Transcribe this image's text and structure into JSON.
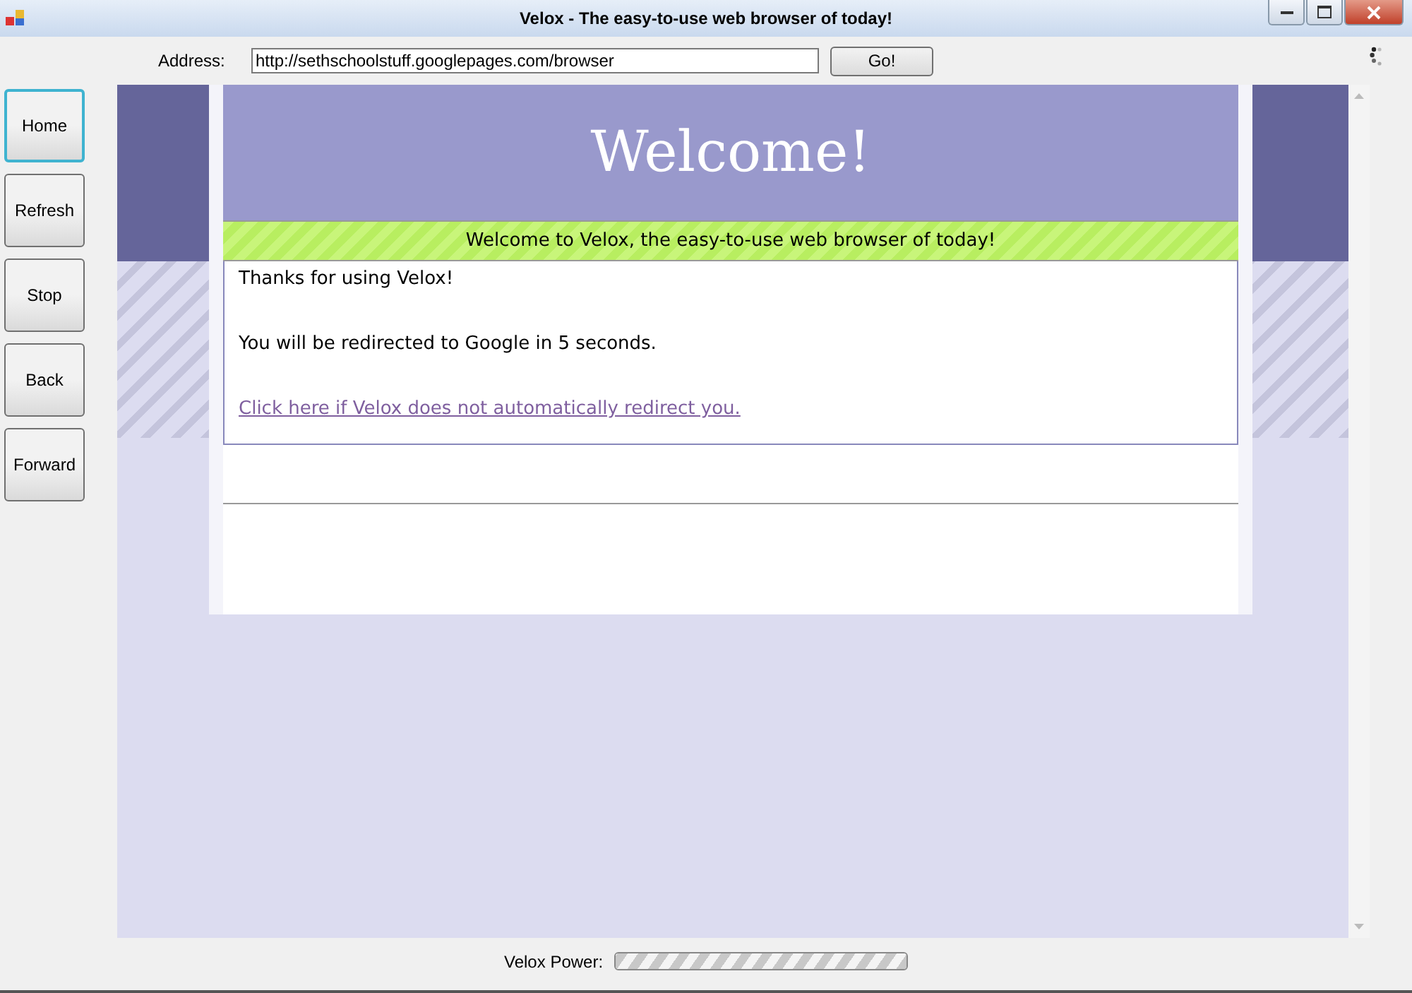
{
  "window": {
    "title": "Velox - The easy-to-use web browser of today!"
  },
  "address": {
    "label": "Address:",
    "value": "http://sethschoolstuff.googlepages.com/browser",
    "go": "Go!"
  },
  "nav_buttons": [
    {
      "label": "Home",
      "focused": true
    },
    {
      "label": "Refresh",
      "focused": false
    },
    {
      "label": "Stop",
      "focused": false
    },
    {
      "label": "Back",
      "focused": false
    },
    {
      "label": "Forward",
      "focused": false
    }
  ],
  "page": {
    "heading": "Welcome!",
    "banner": "Welcome to Velox, the easy-to-use web browser of today!",
    "paragraphs": [
      "Thanks for using Velox!",
      "You will be redirected to Google in 5 seconds."
    ],
    "link": "Click here if Velox does not automatically redirect you."
  },
  "status": {
    "label": "Velox Power:",
    "level": 1
  }
}
